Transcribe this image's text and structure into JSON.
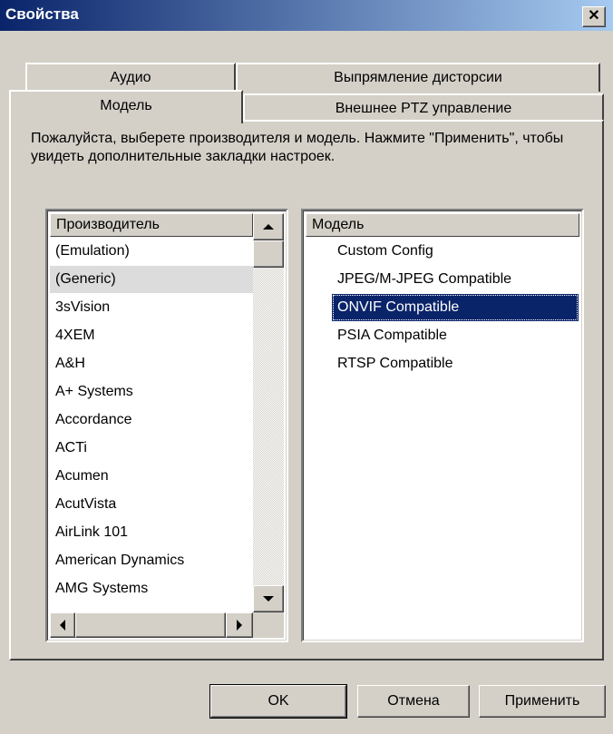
{
  "window": {
    "title": "Свойства",
    "close_icon": "close-icon"
  },
  "tabs": {
    "back_row": [
      {
        "label": "Аудио"
      },
      {
        "label": "Выпрямление дисторсии"
      }
    ],
    "front_row": [
      {
        "label": "Модель"
      },
      {
        "label": "Внешнее PTZ управление"
      }
    ],
    "active": "Модель"
  },
  "panel": {
    "description": "Пожалуйста, выберете производителя и модель. Нажмите \"Применить\", чтобы увидеть дополнительные закладки настроек."
  },
  "manufacturer_list": {
    "header": "Производитель",
    "items": [
      "(Emulation)",
      "(Generic)",
      "3sVision",
      "4XEM",
      "A&H",
      "A+ Systems",
      "Accordance",
      "ACTi",
      "Acumen",
      "AcutVista",
      "AirLink 101",
      "American Dynamics",
      "AMG Systems"
    ],
    "selected": "(Generic)"
  },
  "model_list": {
    "header": "Модель",
    "items": [
      "Custom Config",
      "JPEG/M-JPEG Compatible",
      "ONVIF Compatible",
      "PSIA Compatible",
      "RTSP Compatible"
    ],
    "selected": "ONVIF Compatible"
  },
  "buttons": {
    "ok": "OK",
    "cancel": "Отмена",
    "apply": "Применить"
  }
}
